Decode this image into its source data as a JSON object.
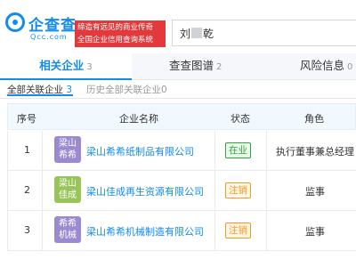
{
  "header": {
    "logo_name": "企查查",
    "logo_sub": "Qcc.com",
    "slogan_line1": "缔造有远见的商业传奇",
    "slogan_line2": "全国企业信用查询系统",
    "search_prefix": "刘",
    "search_suffix": "乾"
  },
  "tabs": [
    {
      "label": "相关企业",
      "count": "3"
    },
    {
      "label": "查查图谱",
      "count": "2"
    },
    {
      "label": "风险信息",
      "count": "0"
    }
  ],
  "subtabs": [
    {
      "label": "全部关联企业",
      "count": "3"
    },
    {
      "label": "历史全部关联企业",
      "count": "0"
    }
  ],
  "table": {
    "headers": [
      "序号",
      "企业名称",
      "状态",
      "角色"
    ],
    "rows": [
      {
        "no": "1",
        "avatar_l1": "梁山",
        "avatar_l2": "希希",
        "avatar_color": "#9b8ad1",
        "company": "梁山希希纸制品有限公司",
        "status": "在业",
        "status_color": "#2fa63b",
        "status_bg": "#eaf7ea",
        "role": "执行董事兼总经理"
      },
      {
        "no": "2",
        "avatar_l1": "梁山",
        "avatar_l2": "佳成",
        "avatar_color": "#98c45a",
        "company": "梁山佳成再生资源有限公司",
        "status": "注销",
        "status_color": "#f29b1d",
        "status_bg": "#fff5e6",
        "role": "监事"
      },
      {
        "no": "3",
        "avatar_l1": "希希",
        "avatar_l2": "机械",
        "avatar_color": "#9b8ad1",
        "company": "梁山希希机械制造有限公司",
        "status": "注销",
        "status_color": "#f29b1d",
        "status_bg": "#fff5e6",
        "role": "监事"
      }
    ]
  },
  "colors": {
    "accent": "#128bed",
    "slogan_bg": "#e4393c"
  },
  "icons": {
    "logo": "magnifier-logo-icon"
  }
}
